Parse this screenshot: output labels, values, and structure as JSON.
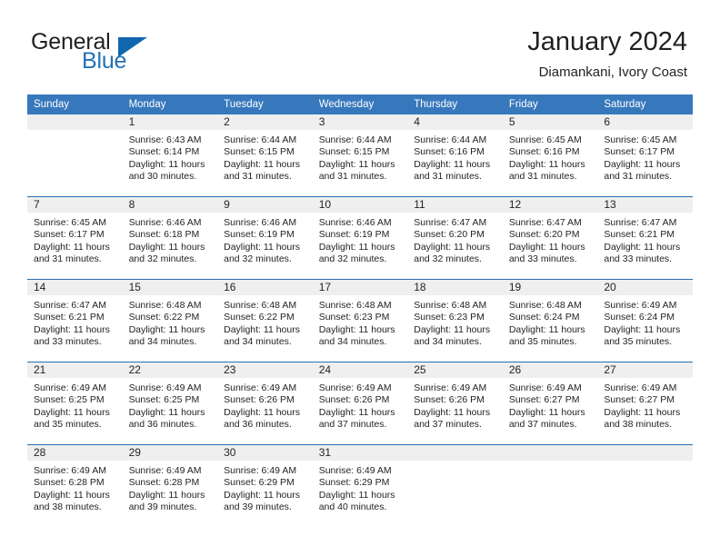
{
  "brand": {
    "word1": "General",
    "word2": "Blue",
    "logo_icon": "blue-triangle-icon",
    "accent_color": "#1166b0"
  },
  "header": {
    "title": "January 2024",
    "subtitle": "Diamankani, Ivory Coast"
  },
  "calendar": {
    "header_bg": "#3778bc",
    "weekday_headers": [
      "Sunday",
      "Monday",
      "Tuesday",
      "Wednesday",
      "Thursday",
      "Friday",
      "Saturday"
    ],
    "weeks": [
      [
        {
          "day": "",
          "empty": true,
          "sunrise": "",
          "sunset": "",
          "daylight": ""
        },
        {
          "day": "1",
          "sunrise": "Sunrise: 6:43 AM",
          "sunset": "Sunset: 6:14 PM",
          "daylight": "Daylight: 11 hours and 30 minutes."
        },
        {
          "day": "2",
          "sunrise": "Sunrise: 6:44 AM",
          "sunset": "Sunset: 6:15 PM",
          "daylight": "Daylight: 11 hours and 31 minutes."
        },
        {
          "day": "3",
          "sunrise": "Sunrise: 6:44 AM",
          "sunset": "Sunset: 6:15 PM",
          "daylight": "Daylight: 11 hours and 31 minutes."
        },
        {
          "day": "4",
          "sunrise": "Sunrise: 6:44 AM",
          "sunset": "Sunset: 6:16 PM",
          "daylight": "Daylight: 11 hours and 31 minutes."
        },
        {
          "day": "5",
          "sunrise": "Sunrise: 6:45 AM",
          "sunset": "Sunset: 6:16 PM",
          "daylight": "Daylight: 11 hours and 31 minutes."
        },
        {
          "day": "6",
          "sunrise": "Sunrise: 6:45 AM",
          "sunset": "Sunset: 6:17 PM",
          "daylight": "Daylight: 11 hours and 31 minutes."
        }
      ],
      [
        {
          "day": "7",
          "sunrise": "Sunrise: 6:45 AM",
          "sunset": "Sunset: 6:17 PM",
          "daylight": "Daylight: 11 hours and 31 minutes."
        },
        {
          "day": "8",
          "sunrise": "Sunrise: 6:46 AM",
          "sunset": "Sunset: 6:18 PM",
          "daylight": "Daylight: 11 hours and 32 minutes."
        },
        {
          "day": "9",
          "sunrise": "Sunrise: 6:46 AM",
          "sunset": "Sunset: 6:19 PM",
          "daylight": "Daylight: 11 hours and 32 minutes."
        },
        {
          "day": "10",
          "sunrise": "Sunrise: 6:46 AM",
          "sunset": "Sunset: 6:19 PM",
          "daylight": "Daylight: 11 hours and 32 minutes."
        },
        {
          "day": "11",
          "sunrise": "Sunrise: 6:47 AM",
          "sunset": "Sunset: 6:20 PM",
          "daylight": "Daylight: 11 hours and 32 minutes."
        },
        {
          "day": "12",
          "sunrise": "Sunrise: 6:47 AM",
          "sunset": "Sunset: 6:20 PM",
          "daylight": "Daylight: 11 hours and 33 minutes."
        },
        {
          "day": "13",
          "sunrise": "Sunrise: 6:47 AM",
          "sunset": "Sunset: 6:21 PM",
          "daylight": "Daylight: 11 hours and 33 minutes."
        }
      ],
      [
        {
          "day": "14",
          "sunrise": "Sunrise: 6:47 AM",
          "sunset": "Sunset: 6:21 PM",
          "daylight": "Daylight: 11 hours and 33 minutes."
        },
        {
          "day": "15",
          "sunrise": "Sunrise: 6:48 AM",
          "sunset": "Sunset: 6:22 PM",
          "daylight": "Daylight: 11 hours and 34 minutes."
        },
        {
          "day": "16",
          "sunrise": "Sunrise: 6:48 AM",
          "sunset": "Sunset: 6:22 PM",
          "daylight": "Daylight: 11 hours and 34 minutes."
        },
        {
          "day": "17",
          "sunrise": "Sunrise: 6:48 AM",
          "sunset": "Sunset: 6:23 PM",
          "daylight": "Daylight: 11 hours and 34 minutes."
        },
        {
          "day": "18",
          "sunrise": "Sunrise: 6:48 AM",
          "sunset": "Sunset: 6:23 PM",
          "daylight": "Daylight: 11 hours and 34 minutes."
        },
        {
          "day": "19",
          "sunrise": "Sunrise: 6:48 AM",
          "sunset": "Sunset: 6:24 PM",
          "daylight": "Daylight: 11 hours and 35 minutes."
        },
        {
          "day": "20",
          "sunrise": "Sunrise: 6:49 AM",
          "sunset": "Sunset: 6:24 PM",
          "daylight": "Daylight: 11 hours and 35 minutes."
        }
      ],
      [
        {
          "day": "21",
          "sunrise": "Sunrise: 6:49 AM",
          "sunset": "Sunset: 6:25 PM",
          "daylight": "Daylight: 11 hours and 35 minutes."
        },
        {
          "day": "22",
          "sunrise": "Sunrise: 6:49 AM",
          "sunset": "Sunset: 6:25 PM",
          "daylight": "Daylight: 11 hours and 36 minutes."
        },
        {
          "day": "23",
          "sunrise": "Sunrise: 6:49 AM",
          "sunset": "Sunset: 6:26 PM",
          "daylight": "Daylight: 11 hours and 36 minutes."
        },
        {
          "day": "24",
          "sunrise": "Sunrise: 6:49 AM",
          "sunset": "Sunset: 6:26 PM",
          "daylight": "Daylight: 11 hours and 37 minutes."
        },
        {
          "day": "25",
          "sunrise": "Sunrise: 6:49 AM",
          "sunset": "Sunset: 6:26 PM",
          "daylight": "Daylight: 11 hours and 37 minutes."
        },
        {
          "day": "26",
          "sunrise": "Sunrise: 6:49 AM",
          "sunset": "Sunset: 6:27 PM",
          "daylight": "Daylight: 11 hours and 37 minutes."
        },
        {
          "day": "27",
          "sunrise": "Sunrise: 6:49 AM",
          "sunset": "Sunset: 6:27 PM",
          "daylight": "Daylight: 11 hours and 38 minutes."
        }
      ],
      [
        {
          "day": "28",
          "sunrise": "Sunrise: 6:49 AM",
          "sunset": "Sunset: 6:28 PM",
          "daylight": "Daylight: 11 hours and 38 minutes."
        },
        {
          "day": "29",
          "sunrise": "Sunrise: 6:49 AM",
          "sunset": "Sunset: 6:28 PM",
          "daylight": "Daylight: 11 hours and 39 minutes."
        },
        {
          "day": "30",
          "sunrise": "Sunrise: 6:49 AM",
          "sunset": "Sunset: 6:29 PM",
          "daylight": "Daylight: 11 hours and 39 minutes."
        },
        {
          "day": "31",
          "sunrise": "Sunrise: 6:49 AM",
          "sunset": "Sunset: 6:29 PM",
          "daylight": "Daylight: 11 hours and 40 minutes."
        },
        {
          "day": "",
          "empty": true,
          "sunrise": "",
          "sunset": "",
          "daylight": ""
        },
        {
          "day": "",
          "empty": true,
          "sunrise": "",
          "sunset": "",
          "daylight": ""
        },
        {
          "day": "",
          "empty": true,
          "sunrise": "",
          "sunset": "",
          "daylight": ""
        }
      ]
    ]
  }
}
